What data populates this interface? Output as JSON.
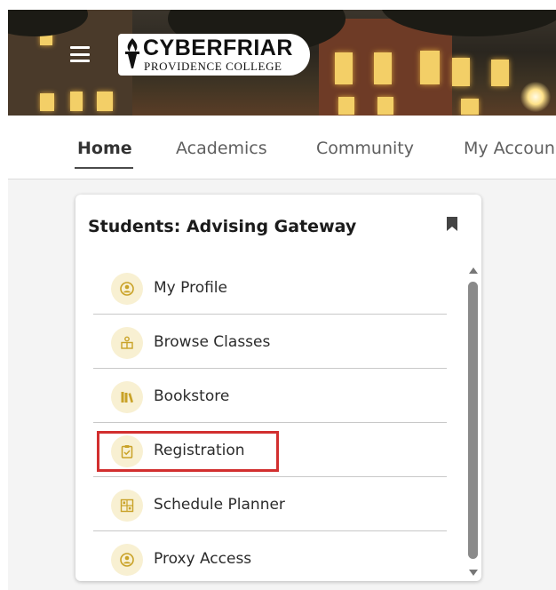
{
  "header": {
    "logo": {
      "title": "CYBERFRIAR",
      "subtitle": "PROVIDENCE COLLEGE"
    },
    "menu_icon": "hamburger-menu-icon"
  },
  "nav": {
    "tabs": [
      {
        "label": "Home",
        "active": true
      },
      {
        "label": "Academics",
        "active": false
      },
      {
        "label": "Community",
        "active": false
      },
      {
        "label": "My Accoun",
        "active": false
      }
    ]
  },
  "card": {
    "title": "Students: Advising Gateway",
    "bookmark_icon": "bookmark-icon",
    "items": [
      {
        "label": "My Profile",
        "icon": "profile-icon"
      },
      {
        "label": "Browse Classes",
        "icon": "browse-classes-icon"
      },
      {
        "label": "Bookstore",
        "icon": "bookstore-icon"
      },
      {
        "label": "Registration",
        "icon": "registration-clipboard-icon",
        "highlighted": true
      },
      {
        "label": "Schedule Planner",
        "icon": "schedule-planner-icon"
      },
      {
        "label": "Proxy Access",
        "icon": "proxy-access-icon"
      }
    ]
  },
  "colors": {
    "accent_gold": "#c9a227",
    "icon_bg": "#f8f0d2",
    "highlight_red": "#d22f2f"
  }
}
